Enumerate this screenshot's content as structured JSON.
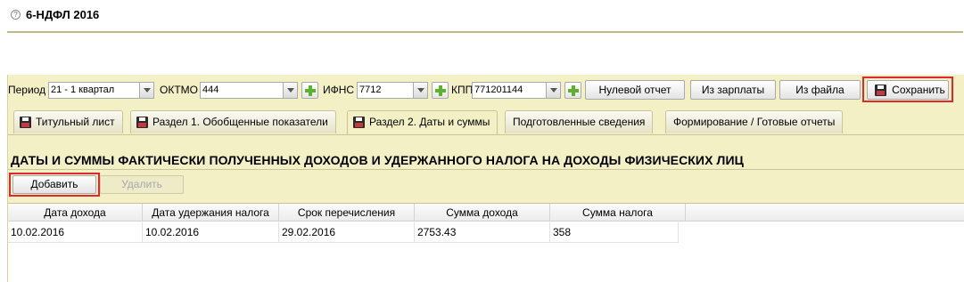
{
  "header": {
    "title": "6-НДФЛ 2016",
    "help_icon": "?"
  },
  "toolbar": {
    "period_label": "Период",
    "period_value": "21 - 1 квартал",
    "oktmo_label": "ОКТМО",
    "oktmo_value": "444",
    "ifns_label": "ИФНС",
    "ifns_value": "7712",
    "kpp_label": "КПП",
    "kpp_value": "771201144",
    "zero_report": "Нулевой отчет",
    "from_salary": "Из зарплаты",
    "from_file": "Из файла",
    "save": "Сохранить"
  },
  "tabs": [
    {
      "label": "Титульный лист"
    },
    {
      "label": "Раздел 1. Обобщенные показатели"
    },
    {
      "label": "Раздел 2. Даты и суммы",
      "active": true
    },
    {
      "label": "Подготовленные сведения"
    },
    {
      "label": "Формирование / Готовые отчеты"
    }
  ],
  "section": {
    "title": "ДАТЫ И СУММЫ ФАКТИЧЕСКИ ПОЛУЧЕННЫХ ДОХОДОВ И УДЕРЖАННОГО НАЛОГА НА ДОХОДЫ ФИЗИЧЕСКИХ ЛИЦ"
  },
  "actions": {
    "add": "Добавить",
    "delete": "Удалить"
  },
  "table": {
    "columns": [
      "Дата дохода",
      "Дата удержания налога",
      "Срок перечисления",
      "Сумма дохода",
      "Сумма налога"
    ],
    "rows": [
      [
        "10.02.2016",
        "10.02.2016",
        "29.02.2016",
        "2753.43",
        "358"
      ]
    ]
  },
  "colors": {
    "panel": "#f3f0c6",
    "highlight": "#e0282e",
    "plus": "#5db12e"
  }
}
